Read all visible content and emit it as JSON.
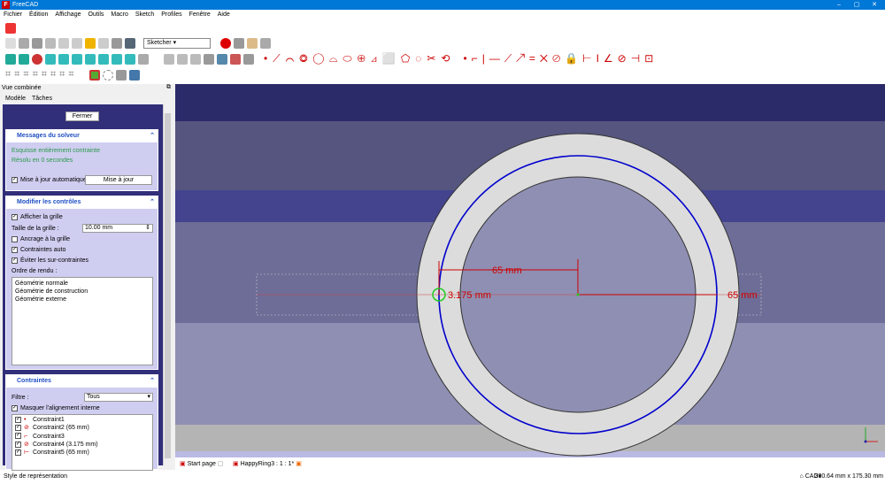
{
  "window": {
    "title": "FreeCAD"
  },
  "menu": [
    "Fichier",
    "Édition",
    "Affichage",
    "Outils",
    "Macro",
    "Sketch",
    "Profiles",
    "Fenêtre",
    "Aide"
  ],
  "toolbar": {
    "workbench": "Sketcher"
  },
  "panel": {
    "title": "Vue combinée",
    "tabs": [
      "Modèle",
      "Tâches"
    ],
    "close_label": "Fermer",
    "solver": {
      "title": "Messages du solveur",
      "status": "Esquisse entièrement contrainte",
      "time": "Résolu en 0 secondes",
      "auto_update": "Mise à jour automatique",
      "update_button": "Mise à jour"
    },
    "controls": {
      "title": "Modifier les contrôles",
      "show_grid": "Afficher la grille",
      "grid_size_label": "Taille de la grille :",
      "grid_size": "10.00 mm",
      "snap": "Ancrage à la grille",
      "auto_constraints": "Contraintes auto",
      "avoid_redundant": "Éviter les sur-contraintes",
      "render_order_label": "Ordre de rendu :",
      "render_order": [
        "Géométrie normale",
        "Géométrie de construction",
        "Géométrie externe"
      ]
    },
    "constraints": {
      "title": "Contraintes",
      "filter_label": "Filtre :",
      "filter_value": "Tous",
      "hide_internal": "Masquer l'alignement interne",
      "items": [
        {
          "label": "Constraint1",
          "icon": "point-on-object-icon"
        },
        {
          "label": "Constraint2 (65 mm)",
          "icon": "radius-icon"
        },
        {
          "label": "Constraint3",
          "icon": "horizontal-distance-icon"
        },
        {
          "label": "Constraint4 (3.175 mm)",
          "icon": "radius-icon"
        },
        {
          "label": "Constraint5 (65 mm)",
          "icon": "horizontal-distance-icon"
        }
      ]
    }
  },
  "viewport": {
    "dim_top": "65 mm",
    "dim_left": "3.175 mm",
    "dim_right": "65 mm"
  },
  "doc_tabs": [
    "Start page",
    "HappyRing3 : 1 : 1*"
  ],
  "status": {
    "left": "Style de représentation",
    "nav": "CAD",
    "dims": "330.64 mm x 175.30 mm"
  },
  "colors": {
    "accent": "#0078d7",
    "constraint": "#cc0000",
    "circle": "#0000cc"
  }
}
